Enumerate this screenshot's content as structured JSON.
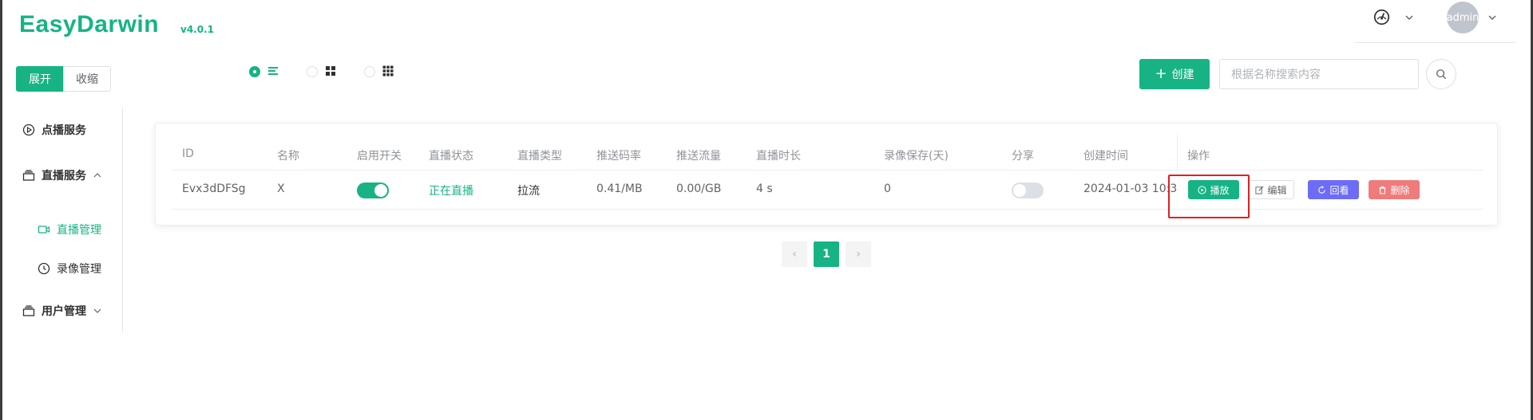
{
  "app": {
    "name": "EasyDarwin",
    "version": "v4.0.1"
  },
  "header": {
    "user": "admin",
    "icons": [
      "dashboard-gauge-icon",
      "chevron-down-icon",
      "avatar",
      "chevron-down-icon"
    ]
  },
  "toggle": {
    "expand": "展开",
    "collapse": "收缩",
    "selected": "expand"
  },
  "view_modes": {
    "selected": "list",
    "options": [
      "list",
      "grid",
      "grid-dense"
    ]
  },
  "toolbar": {
    "create_label": "创建",
    "search_placeholder": "根据名称搜索内容",
    "search_value": ""
  },
  "sidebar": {
    "items": [
      {
        "label": "点播服务",
        "icon": "play-circle-icon"
      },
      {
        "label": "直播服务",
        "icon": "stack-icon",
        "expanded": true,
        "children": [
          {
            "label": "直播管理",
            "icon": "camera-icon",
            "active": true
          },
          {
            "label": "录像管理",
            "icon": "clock-icon"
          }
        ]
      },
      {
        "label": "用户管理",
        "icon": "stack-icon",
        "expanded": false
      }
    ]
  },
  "table": {
    "columns": [
      "ID",
      "名称",
      "启用开关",
      "直播状态",
      "直播类型",
      "推送码率",
      "推送流量",
      "直播时长",
      "录像保存(天)",
      "分享",
      "创建时间",
      "操作"
    ],
    "rows": [
      {
        "id": "Evx3dDFSg",
        "name": "X",
        "enabled": true,
        "status": "正在直播",
        "type": "拉流",
        "bitrate": "0.41/MB",
        "traffic": "0.00/GB",
        "duration": "4 s",
        "record_days": "0",
        "share": false,
        "created": "2024-01-03 10:33:2"
      }
    ],
    "actions": {
      "play": "播放",
      "edit": "编辑",
      "playback": "回看",
      "delete": "删除"
    }
  },
  "pagination": {
    "prev": "‹",
    "current": "1",
    "next": "›"
  },
  "colors": {
    "primary": "#17b385",
    "playback": "#6c6cf6",
    "danger": "#f07b7b",
    "highlight_box": "#e02020"
  }
}
